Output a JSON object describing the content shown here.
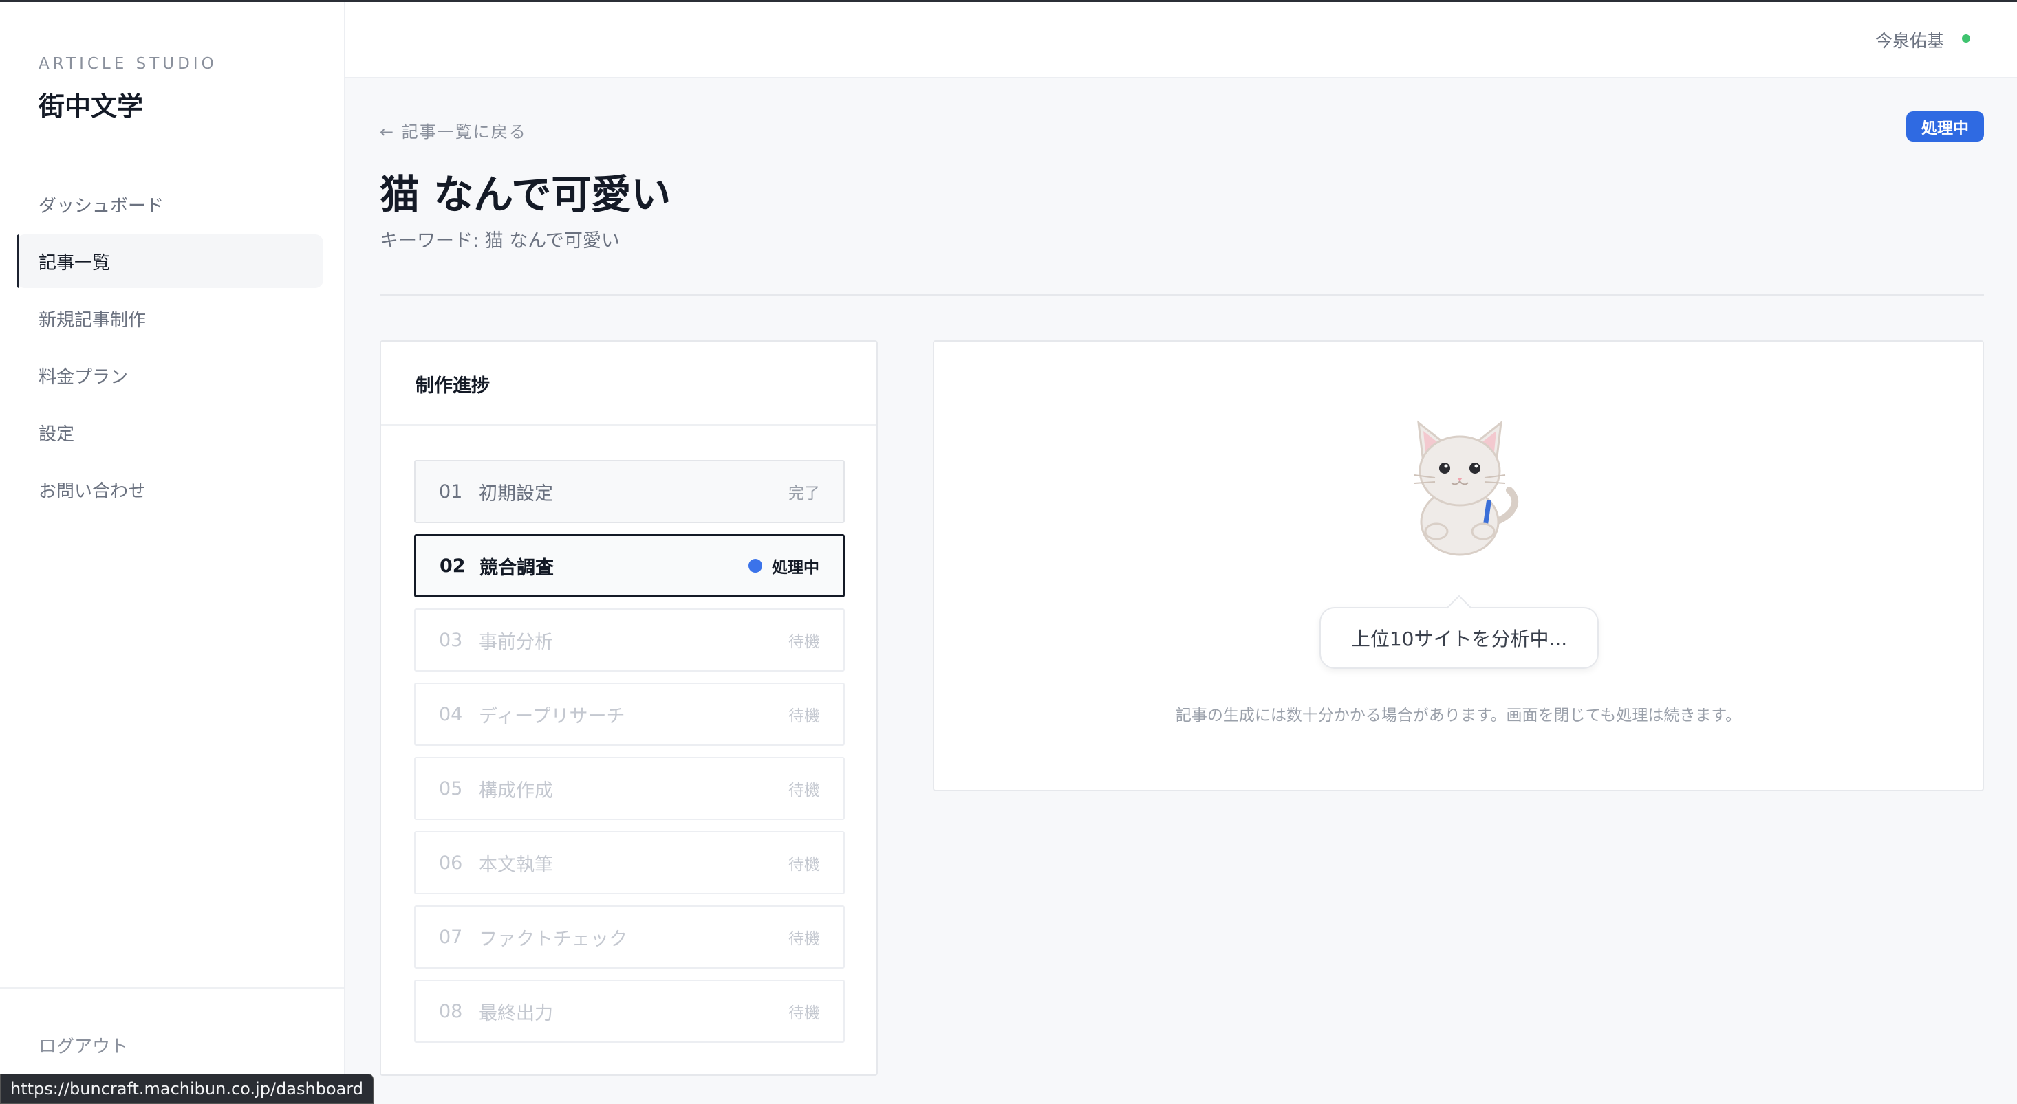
{
  "sidebar": {
    "brand_sub": "ARTICLE STUDIO",
    "brand_title": "街中文学",
    "items": [
      {
        "label": "ダッシュボード"
      },
      {
        "label": "記事一覧"
      },
      {
        "label": "新規記事制作"
      },
      {
        "label": "料金プラン"
      },
      {
        "label": "設定"
      },
      {
        "label": "お問い合わせ"
      }
    ],
    "logout": "ログアウト"
  },
  "header": {
    "user_name": "今泉佑基"
  },
  "main": {
    "back_link": "← 記事一覧に戻る",
    "status_badge": "処理中",
    "title": "猫 なんで可愛い",
    "keyword_line": "キーワード: 猫 なんで可愛い"
  },
  "progress": {
    "title": "制作進捗",
    "steps": [
      {
        "num": "01",
        "label": "初期設定",
        "status": "完了"
      },
      {
        "num": "02",
        "label": "競合調査",
        "status": "処理中"
      },
      {
        "num": "03",
        "label": "事前分析",
        "status": "待機"
      },
      {
        "num": "04",
        "label": "ディープリサーチ",
        "status": "待機"
      },
      {
        "num": "05",
        "label": "構成作成",
        "status": "待機"
      },
      {
        "num": "06",
        "label": "本文執筆",
        "status": "待機"
      },
      {
        "num": "07",
        "label": "ファクトチェック",
        "status": "待機"
      },
      {
        "num": "08",
        "label": "最終出力",
        "status": "待機"
      }
    ]
  },
  "analysis": {
    "bubble_text": "上位10サイトを分析中...",
    "notice": "記事の生成には数十分かかる場合があります。画面を閉じても処理は続きます。"
  },
  "browser": {
    "status_url": "https://buncraft.machibun.co.jp/dashboard"
  },
  "colors": {
    "accent": "#2f6ae2",
    "active_dot": "#3b73ea",
    "online": "#3fc36f"
  }
}
